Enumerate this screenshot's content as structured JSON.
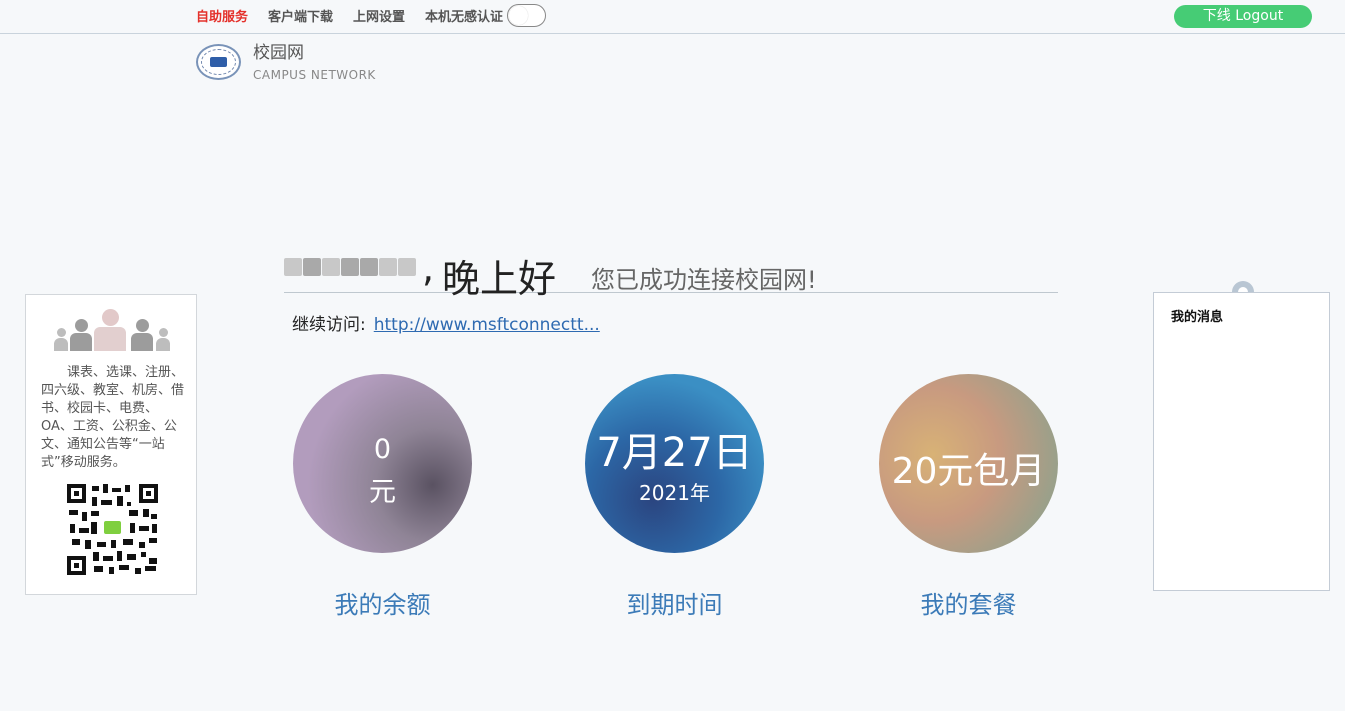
{
  "top_nav": {
    "items": [
      {
        "label": "自助服务",
        "active": true
      },
      {
        "label": "客户端下载",
        "active": false
      },
      {
        "label": "上网设置",
        "active": false
      }
    ],
    "seamless_auth_label": "本机无感认证",
    "seamless_auth_enabled": false,
    "logout_label": "下线 Logout"
  },
  "brand": {
    "title": "校园网",
    "subtitle": "CAMPUS  NETWORK"
  },
  "greeting": {
    "comma": ",",
    "salutation": "晚上好",
    "status": "您已成功连接校园网!"
  },
  "continue": {
    "label": "继续访问:",
    "url": "http://www.msftconnectt..."
  },
  "cards": {
    "balance": {
      "value": "0",
      "unit": "元",
      "label": "我的余额"
    },
    "expiry": {
      "date": "7月27日",
      "year": "2021年",
      "label": "到期时间"
    },
    "plan": {
      "value": "20元包月",
      "label": "我的套餐"
    }
  },
  "promo": {
    "text": "课表、选课、注册、四六级、教室、机房、借书、校园卡、电费、OA、工资、公积金、公文、通知公告等“一站式”移动服务。"
  },
  "messages": {
    "title": "我的消息"
  },
  "colors": {
    "active_nav": "#e4312b",
    "logout_button": "#46cc75",
    "link": "#2e6ab1",
    "card_label": "#3c7bb8"
  }
}
